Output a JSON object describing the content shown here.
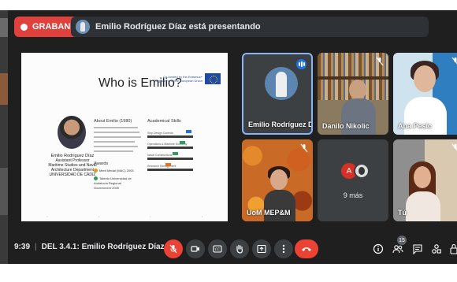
{
  "recording": {
    "label": "GRABANDO"
  },
  "presenting": {
    "text": "Emilio Rodríguez Díaz está presentando"
  },
  "slide": {
    "title": "Who is Emilio?",
    "eu_text": "Co-funded by the Erasmus+ Programme of the European Union",
    "about_heading": "About Emilio (1980)",
    "skills_heading": "Academical Skills",
    "awards_heading": "Awards",
    "awards": [
      "Merit Medal (MAC) 2005",
      "Talento Universidad de Andalucía Regional Government 2009"
    ],
    "skills": [
      {
        "label": "Ship Design Controls",
        "level": 0.85,
        "color": "#1a73e8"
      },
      {
        "label": "Operations & Maritime Economy",
        "level": 0.7,
        "color": "#2e9e58"
      },
      {
        "label": "Naval Constructions",
        "level": 0.55,
        "color": "#2e9e58"
      },
      {
        "label": "Research Management",
        "level": 0.4,
        "color": "#e8711a"
      }
    ],
    "person": {
      "name": "Emilio Rodríguez Díaz",
      "role": "Assistant Professor",
      "dept1": "Maritime Studies and Naval",
      "dept2": "Architecture Department",
      "univ": "UNIVERSIDAD DE CÁDIZ"
    }
  },
  "participants": [
    {
      "name": "Emilio Rodríguez Díaz",
      "speaking": true
    },
    {
      "name": "Danilo Nikolic",
      "muted": true
    },
    {
      "name": "Ana Pesic",
      "muted": true
    },
    {
      "name": "UoM MEP&M",
      "muted": true
    },
    {
      "name": "9 más",
      "avatar_initial": "A"
    },
    {
      "name": "Tú",
      "muted": true
    }
  ],
  "bottom_bar": {
    "time": "9:39",
    "meeting_name": "DEL 3.4.1: Emilio Rodríguez Díaz",
    "participant_count": "15"
  },
  "icons": {
    "controls": [
      "mic-off-icon",
      "camera-icon",
      "captions-icon",
      "raise-hand-icon",
      "present-icon",
      "more-options-icon",
      "leave-call-icon"
    ],
    "right": [
      "info-icon",
      "people-icon",
      "chat-icon",
      "activities-icon",
      "lock-icon"
    ]
  },
  "colors": {
    "recording": "#e0413c",
    "active_speaker_border": "#8ab4f8",
    "leave": "#ea4335",
    "background": "#1f1f1f"
  }
}
